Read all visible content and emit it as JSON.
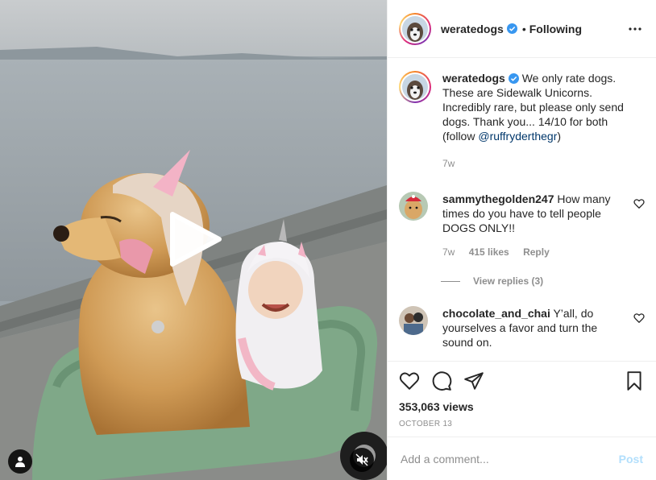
{
  "header": {
    "username": "weratedogs",
    "separator": "•",
    "following_label": "Following"
  },
  "caption": {
    "username": "weratedogs",
    "text": "We only rate dogs. These are Sidewalk Unicorns. Incredibly rare, but please only send dogs. Thank you... 14/10 for both (follow ",
    "mention": "@ruffryderthegr",
    "closing": ")",
    "time": "7w"
  },
  "comments": [
    {
      "username": "sammythegolden247",
      "text": "How many times do you have to tell people DOGS ONLY!!",
      "time": "7w",
      "likes": "415 likes",
      "reply_label": "Reply",
      "view_replies": "View replies (3)"
    },
    {
      "username": "chocolate_and_chai",
      "text": "Y’all, do yourselves a favor and turn the sound on."
    }
  ],
  "stats": {
    "views": "353,063 views",
    "date": "OCTOBER 13"
  },
  "composer": {
    "placeholder": "Add a comment...",
    "post_label": "Post"
  },
  "colors": {
    "verified": "#3897f0",
    "link": "#00376b",
    "post_disabled": "#b2dffc"
  }
}
